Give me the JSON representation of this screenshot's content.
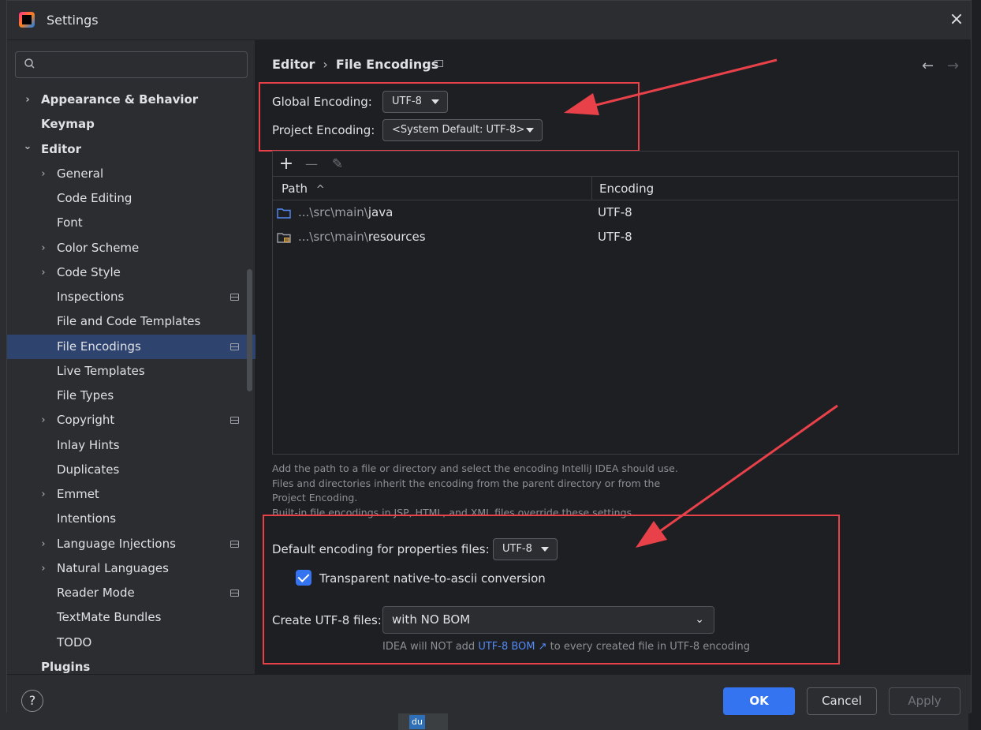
{
  "window": {
    "title": "Settings",
    "close_icon": "×"
  },
  "search": {
    "placeholder": ""
  },
  "sidebar": {
    "items": [
      {
        "label": "Appearance & Behavior",
        "bold": true,
        "level": 0,
        "expandable": true,
        "expanded": false
      },
      {
        "label": "Keymap",
        "bold": true,
        "level": 0,
        "expandable": false
      },
      {
        "label": "Editor",
        "bold": true,
        "level": 0,
        "expandable": true,
        "expanded": true
      },
      {
        "label": "General",
        "level": 1,
        "expandable": true
      },
      {
        "label": "Code Editing",
        "level": 1
      },
      {
        "label": "Font",
        "level": 1
      },
      {
        "label": "Color Scheme",
        "level": 1,
        "expandable": true
      },
      {
        "label": "Code Style",
        "level": 1,
        "expandable": true
      },
      {
        "label": "Inspections",
        "level": 1,
        "project": true
      },
      {
        "label": "File and Code Templates",
        "level": 1
      },
      {
        "label": "File Encodings",
        "level": 1,
        "project": true,
        "selected": true
      },
      {
        "label": "Live Templates",
        "level": 1
      },
      {
        "label": "File Types",
        "level": 1
      },
      {
        "label": "Copyright",
        "level": 1,
        "expandable": true,
        "project": true
      },
      {
        "label": "Inlay Hints",
        "level": 1
      },
      {
        "label": "Duplicates",
        "level": 1
      },
      {
        "label": "Emmet",
        "level": 1,
        "expandable": true
      },
      {
        "label": "Intentions",
        "level": 1
      },
      {
        "label": "Language Injections",
        "level": 1,
        "expandable": true,
        "project": true
      },
      {
        "label": "Natural Languages",
        "level": 1,
        "expandable": true
      },
      {
        "label": "Reader Mode",
        "level": 1,
        "project": true
      },
      {
        "label": "TextMate Bundles",
        "level": 1
      },
      {
        "label": "TODO",
        "level": 1
      },
      {
        "label": "Plugins",
        "bold": true,
        "level": 0
      }
    ]
  },
  "breadcrumb": {
    "parent": "Editor",
    "separator": "›",
    "current": "File Encodings"
  },
  "nav": {
    "back": "←",
    "forward": "→"
  },
  "encoding": {
    "global_label": "Global Encoding:",
    "global_value": "UTF-8",
    "project_label": "Project Encoding:",
    "project_value": "<System Default: UTF-8>"
  },
  "table": {
    "toolbar": {
      "add": "+",
      "remove": "—",
      "edit": "✎"
    },
    "headers": {
      "path": "Path",
      "sort_indicator": "^",
      "encoding": "Encoding"
    },
    "rows": [
      {
        "path_prefix": "...\\src\\main\\",
        "path_name": "java",
        "encoding": "UTF-8",
        "icon": "folder-icon"
      },
      {
        "path_prefix": "...\\src\\main\\",
        "path_name": "resources",
        "encoding": "UTF-8",
        "icon": "resources-folder-icon"
      }
    ]
  },
  "help": {
    "line1": "Add the path to a file or directory and select the encoding IntelliJ IDEA should use.",
    "line2": "Files and directories inherit the encoding from the parent directory or from the",
    "line3": "Project Encoding.",
    "line4": "Built-in file encodings in JSP, HTML, and XML files override these settings."
  },
  "properties": {
    "label": "Default encoding for properties files:",
    "value": "UTF-8",
    "native_to_ascii_label": "Transparent native-to-ascii conversion",
    "native_to_ascii_checked": true
  },
  "bom": {
    "label": "Create UTF-8 files:",
    "value": "with NO BOM",
    "note_prefix": "IDEA will NOT add",
    "note_link": "UTF-8 BOM ↗",
    "note_suffix": "to every created file in UTF-8 encoding"
  },
  "footer": {
    "help": "?",
    "ok": "OK",
    "cancel": "Cancel",
    "apply": "Apply"
  },
  "colors": {
    "accent": "#3574f0",
    "selection": "#2e436e",
    "annotation": "#e8414a",
    "link": "#548af7"
  }
}
